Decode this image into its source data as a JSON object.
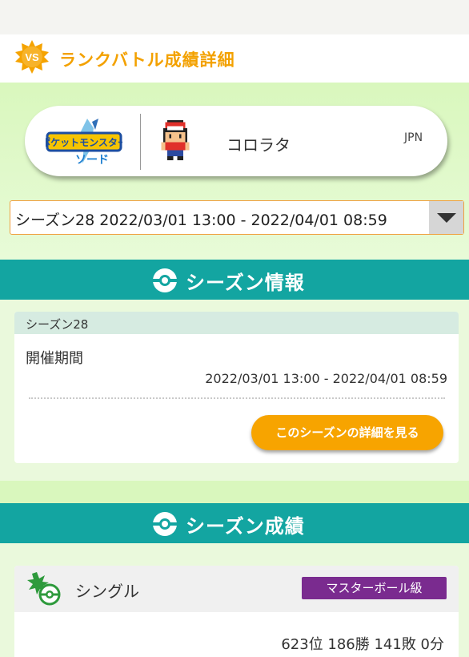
{
  "header": {
    "badge_text": "VS",
    "title": "ランクバトル成績詳細"
  },
  "trainer": {
    "game_logo_text": "ポケットモンスター ソード",
    "name": "コロラタ",
    "region": "JPN"
  },
  "season_select": {
    "value": "シーズン28 2022/03/01 13:00 - 2022/04/01 08:59"
  },
  "season_info": {
    "section_title": "シーズン情報",
    "card_title": "シーズン28",
    "period_label": "開催期間",
    "period_value": "2022/03/01 13:00 - 2022/04/01 08:59",
    "detail_button_label": "このシーズンの詳細を見る"
  },
  "season_results": {
    "section_title": "シーズン成績",
    "single": {
      "label": "シングル",
      "rank_class": "マスターボール級",
      "record": "623位 186勝 141敗 0分"
    }
  },
  "colors": {
    "accent_orange": "#f3a100",
    "teal": "#13a5a1",
    "light_green": "#d9f7bd",
    "master_ball_purple": "#7a2b8f",
    "button_orange": "#f7a400"
  }
}
